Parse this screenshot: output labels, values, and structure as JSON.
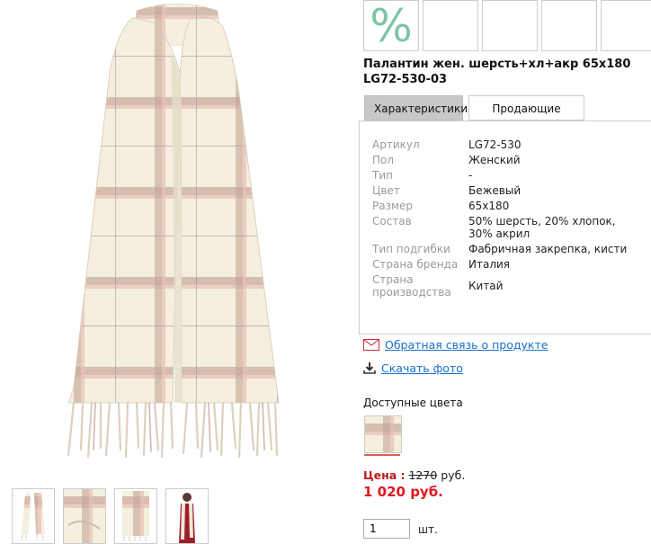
{
  "product": {
    "title_line1": "Палантин жен. шерсть+хл+акр 65х180",
    "title_line2": "LG72-530-03"
  },
  "badges": {
    "discount_symbol": "%"
  },
  "tabs": [
    {
      "label": "Характеристики",
      "active": true
    },
    {
      "label": "Продающие фразы",
      "active": false
    }
  ],
  "specs": [
    {
      "label": "Артикул",
      "value": "LG72-530"
    },
    {
      "label": "Пол",
      "value": "Женский"
    },
    {
      "label": "Тип",
      "value": "-"
    },
    {
      "label": "Цвет",
      "value": "Бежевый"
    },
    {
      "label": "Размер",
      "value": "65x180"
    },
    {
      "label": "Состав",
      "value": "50% шерсть, 20% хлопок, 30% акрил"
    },
    {
      "label": "Тип подгибки",
      "value": "Фабричная закрепка, кисти"
    },
    {
      "label": "Страна бренда",
      "value": "Италия"
    },
    {
      "label": "Страна производства",
      "value": "Китай"
    }
  ],
  "links": {
    "feedback": "Обратная связь о продукте",
    "download_photo": "Скачать фото"
  },
  "colors": {
    "label": "Доступные цвета"
  },
  "price": {
    "label": "Цена :",
    "old_value": "1270",
    "old_currency": "руб.",
    "new_price": "1 020 руб."
  },
  "quantity": {
    "value": "1",
    "unit": "шт."
  },
  "palette": {
    "cream": "#f4efdf",
    "stripe_brown": "#b08a7a",
    "stripe_pink": "#e6b5ab",
    "accent_red": "#e2171e",
    "link_blue": "#1a6fc9"
  }
}
